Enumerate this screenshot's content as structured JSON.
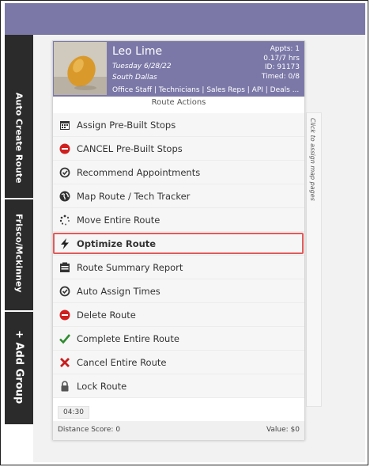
{
  "sidebar": {
    "tabs": [
      {
        "label": "Auto Create Route"
      },
      {
        "label": "Frisco/Mckinney"
      },
      {
        "label": "+ Add Group"
      }
    ]
  },
  "route_card": {
    "tech_name": "Leo Lime",
    "date": "Tuesday 6/28/22",
    "region": "South Dallas",
    "roles": "Office Staff | Technicians | Sales Reps | API | Deals ...",
    "stats": {
      "appts": "Appts: 1",
      "hours": "0.17/7 hrs",
      "id": "ID: 91173",
      "timed": "Timed: 0/8"
    },
    "section_title": "Route Actions",
    "side_label": "Click to assign map pages",
    "actions": [
      {
        "label": "Assign Pre-Built Stops",
        "icon": "calendar-icon"
      },
      {
        "label": "CANCEL Pre-Built Stops",
        "icon": "stop-red-icon"
      },
      {
        "label": "Recommend Appointments",
        "icon": "clock-check-icon"
      },
      {
        "label": "Map Route / Tech Tracker",
        "icon": "globe-icon"
      },
      {
        "label": "Move Entire Route",
        "icon": "spinner-icon"
      },
      {
        "label": "Optimize Route",
        "icon": "bolt-icon"
      },
      {
        "label": "Route Summary Report",
        "icon": "clipboard-icon"
      },
      {
        "label": "Auto Assign Times",
        "icon": "clock-check-icon"
      },
      {
        "label": "Delete Route",
        "icon": "stop-red-icon"
      },
      {
        "label": "Complete Entire Route",
        "icon": "checkmark-icon"
      },
      {
        "label": "Cancel Entire Route",
        "icon": "x-red-icon"
      },
      {
        "label": "Lock Route",
        "icon": "lock-icon"
      }
    ],
    "time_badge": "04:30",
    "distance_score": "Distance Score: 0",
    "value": "Value: $0"
  },
  "colors": {
    "header_purple": "#7b78a8",
    "sidebar_dark": "#2b2b2b",
    "highlight_red": "#e25a5a"
  }
}
